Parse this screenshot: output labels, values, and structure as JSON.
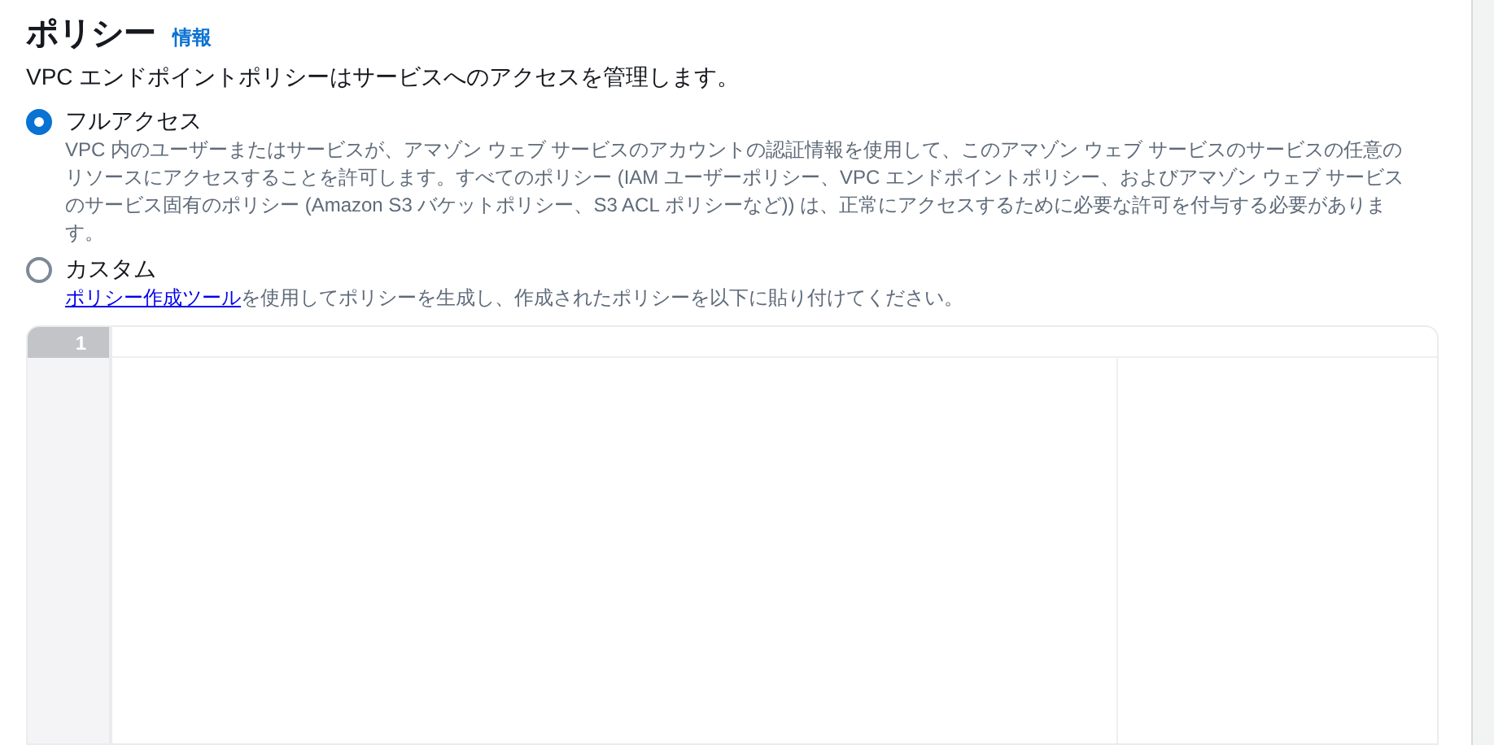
{
  "header": {
    "title": "ポリシー",
    "info_link": "情報",
    "description": "VPC エンドポイントポリシーはサービスへのアクセスを管理します。"
  },
  "options": [
    {
      "label": "フルアクセス",
      "selected": true,
      "description": "VPC 内のユーザーまたはサービスが、アマゾン ウェブ サービスのアカウントの認証情報を使用して、このアマゾン ウェブ サービスのサービスの任意のリソースにアクセスすることを許可します。すべてのポリシー (IAM ユーザーポリシー、VPC エンドポイントポリシー、およびアマゾン ウェブ サービスのサービス固有のポリシー (Amazon S3 バケットポリシー、S3 ACL ポリシーなど)) は、正常にアクセスするために必要な許可を付与する必要があります。"
    },
    {
      "label": "カスタム",
      "selected": false,
      "link": "ポリシー作成ツール",
      "description": "を使用してポリシーを生成し、作成されたポリシーを以下に貼り付けてください。"
    }
  ],
  "editor": {
    "line_numbers": [
      "1"
    ]
  }
}
